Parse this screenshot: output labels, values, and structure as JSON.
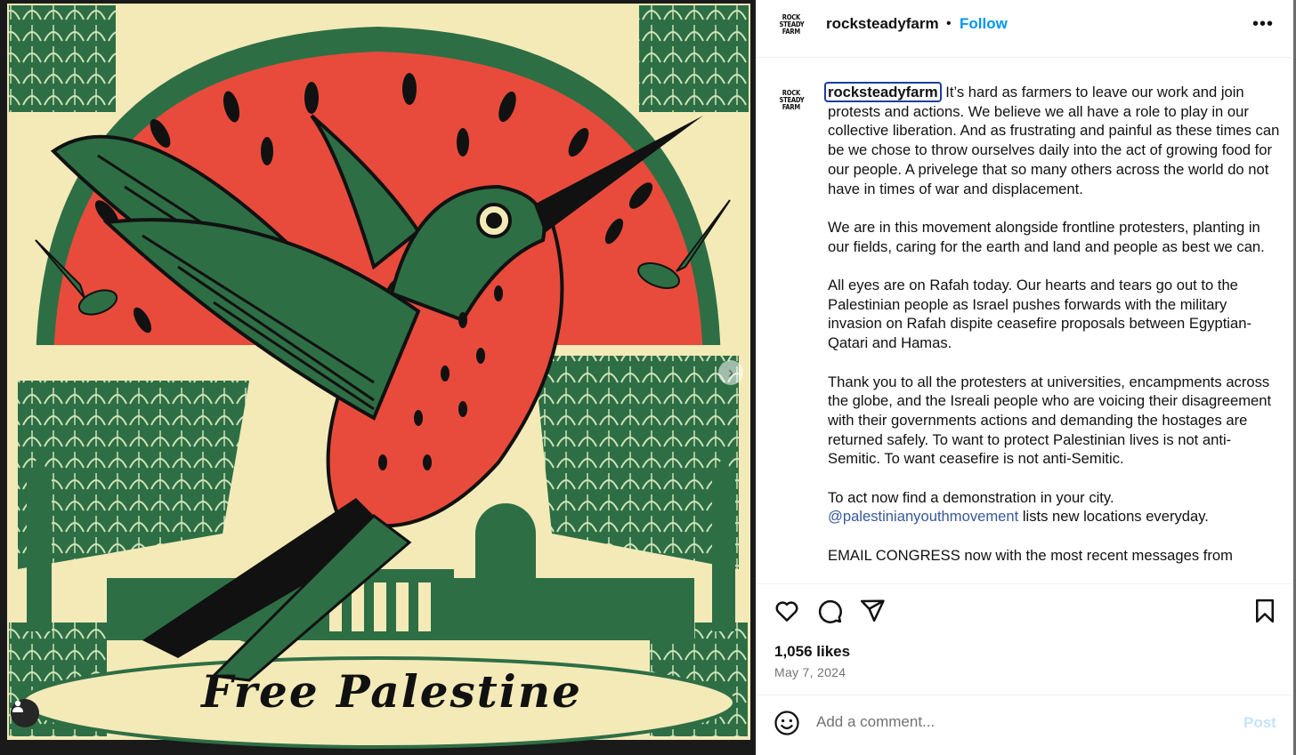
{
  "post": {
    "image": {
      "caption_art_text": "Free Palestine",
      "alt": "Linocut-style illustration of a hummingbird with watermelon sun",
      "colors": {
        "red": "#e84b3c",
        "green": "#2e6e45",
        "cream": "#f3eab8",
        "dark": "#111111"
      }
    },
    "header": {
      "logo_lines": [
        "ROCK",
        "STEADY",
        "FARM"
      ],
      "username": "rocksteadyfarm",
      "separator": "•",
      "follow_label": "Follow",
      "more_icon": "more-horizontal-icon"
    },
    "caption": {
      "username": "rocksteadyfarm",
      "p1": "It’s hard as farmers to leave our work and join protests and actions. We believe we all have a role to play in our collective liberation. And as frustrating and painful as these times can be we chose to throw ourselves daily into the act of growing food for our people. A privelege that so many others across the world do not have in times of war and displacement.",
      "p2": "We are in this movement alongside frontline protesters, planting in our fields, caring for the earth and land and people as best we can.",
      "p3": "All eyes are on Rafah today. Our hearts and tears go out to the Palestinian people as Israel pushes forwards with the military invasion on Rafah dispite ceasefire proposals between Egyptian-Qatari and Hamas.",
      "p4": "Thank you to all the protesters at universities, encampments across the globe, and the Isreali people who are voicing their disagreement with their governments actions and demanding the hostages are returned safely. To want to protect Palestinian lives is not anti-Semitic. To want ceasefire is not anti-Semitic.",
      "p5": "To act now find a demonstration in your city.",
      "mention": "@palestinianyouthmovement",
      "p5b": " lists new locations everyday.",
      "p6": "EMAIL CONGRESS now with the most recent messages from"
    },
    "actions": {
      "icons": [
        "heart-icon",
        "comment-icon",
        "share-icon",
        "bookmark-icon"
      ]
    },
    "likes": "1,056 likes",
    "date": "May 7, 2024",
    "comment": {
      "placeholder": "Add a comment...",
      "value": "",
      "post_label": "Post"
    }
  }
}
